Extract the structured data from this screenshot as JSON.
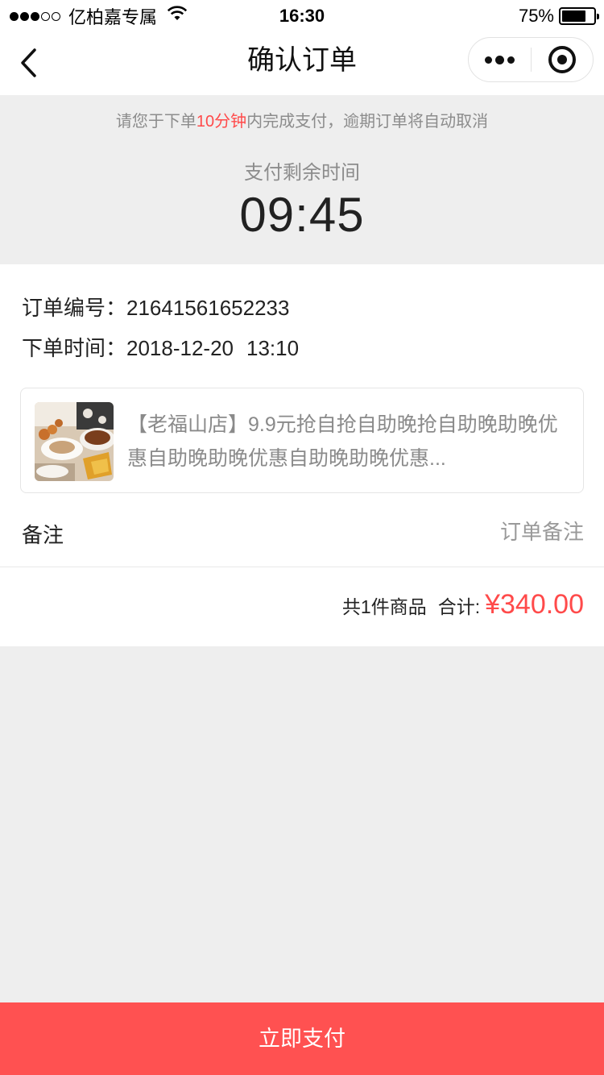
{
  "status_bar": {
    "carrier": "亿柏嘉专属",
    "time": "16:30",
    "battery_text": "75%",
    "battery_level": 0.75,
    "signal_filled": 3,
    "signal_total": 5
  },
  "nav": {
    "title": "确认订单",
    "back_icon": "chevron-left-icon",
    "more_icon": "more-dots-icon",
    "close_icon": "target-close-icon"
  },
  "timer": {
    "notice_prefix": "请您于下单",
    "notice_highlight": "10分钟",
    "notice_suffix": "内完成支付，逾期订单将自动取消",
    "label": "支付剩余时间",
    "value": "09:45"
  },
  "order": {
    "number_label": "订单编号：",
    "number_value": "21641561652233",
    "time_label": "下单时间：",
    "date_value": "2018-12-20",
    "time_value": "13:10"
  },
  "product": {
    "title": "【老福山店】9.9元抢自抢自助晚抢自助晚助晚优惠自助晚助晚优惠自助晚助晚优惠...",
    "image_icon": "food-photo"
  },
  "remark": {
    "label": "备注",
    "placeholder": "订单备注",
    "value": ""
  },
  "total": {
    "count_text": "共1件商品",
    "label": "合计:",
    "amount": "¥340.00"
  },
  "pay_button": {
    "label": "立即支付"
  },
  "colors": {
    "accent": "#ff5151",
    "price": "#ff4a4a",
    "background": "#eeeeee"
  }
}
